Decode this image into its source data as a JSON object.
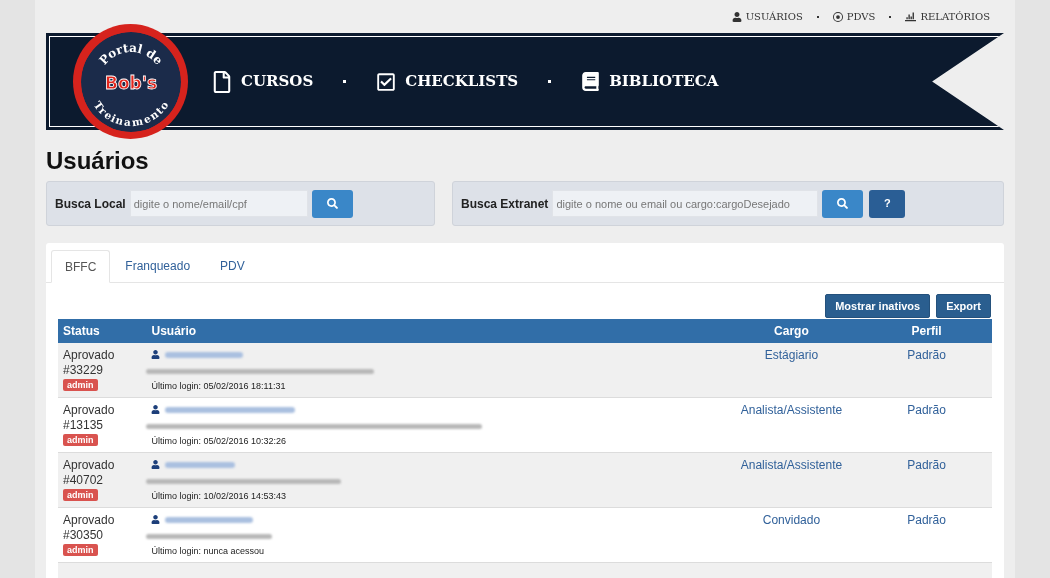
{
  "top_nav": [
    {
      "kind": "user",
      "label": "USUÁRIOS"
    },
    {
      "kind": "target",
      "label": "PDVS"
    },
    {
      "kind": "chart",
      "label": "RELATÓRIOS"
    }
  ],
  "logo": {
    "top": "Portal de",
    "brand": "Bob's",
    "bottom": "Treinamento"
  },
  "main_nav": [
    {
      "kind": "file",
      "label": "CURSOS"
    },
    {
      "kind": "check",
      "label": "CHECKLISTS"
    },
    {
      "kind": "book",
      "label": "BIBLIOTECA"
    }
  ],
  "page_title": "Usuários",
  "local_search": {
    "label": "Busca Local",
    "placeholder": "digite o nome/email/cpf"
  },
  "extranet_search": {
    "label": "Busca Extranet",
    "placeholder": "digite o nome ou email ou cargo:cargoDesejado",
    "help": "?"
  },
  "tabs": [
    {
      "label": "BFFC",
      "selected": true
    },
    {
      "label": "Franqueado",
      "selected": false
    },
    {
      "label": "PDV",
      "selected": false
    }
  ],
  "actions": [
    "Mostrar inativos",
    "Export"
  ],
  "table": {
    "columns": [
      "Status",
      "Usuário",
      "Cargo",
      "Perfil"
    ],
    "rows": [
      {
        "status": "Aprovado",
        "id": "#33229",
        "badge": "admin",
        "last_login": "Último login: 05/02/2016 18:11:31",
        "cargo": "Estágiario",
        "perfil": "Padrão"
      },
      {
        "status": "Aprovado",
        "id": "#13135",
        "badge": "admin",
        "last_login": "Último login: 05/02/2016 10:32:26",
        "cargo": "Analista/Assistente",
        "perfil": "Padrão"
      },
      {
        "status": "Aprovado",
        "id": "#40702",
        "badge": "admin",
        "last_login": "Último login: 10/02/2016 14:53:43",
        "cargo": "Analista/Assistente",
        "perfil": "Padrão"
      },
      {
        "status": "Aprovado",
        "id": "#30350",
        "badge": "admin",
        "last_login": "Último login: nunca acessou",
        "cargo": "Convidado",
        "perfil": "Padrão"
      }
    ]
  }
}
